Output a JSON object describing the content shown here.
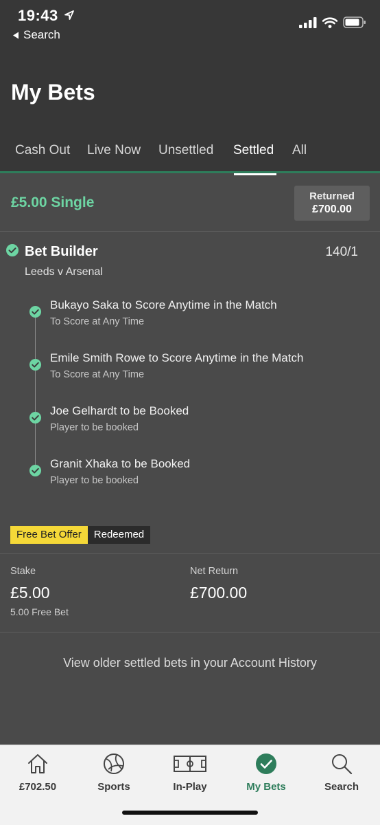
{
  "status_bar": {
    "time": "19:43",
    "back_label": "Search"
  },
  "page_title": "My Bets",
  "tabs": [
    {
      "label": "Cash Out"
    },
    {
      "label": "Live Now"
    },
    {
      "label": "Unsettled"
    },
    {
      "label": "Settled",
      "active": true
    },
    {
      "label": "All"
    }
  ],
  "bet": {
    "title": "£5.00 Single",
    "returned_label": "Returned",
    "returned_value": "£700.00",
    "builder_title": "Bet Builder",
    "odds": "140/1",
    "match": "Leeds v Arsenal",
    "legs": [
      {
        "name": "Bukayo Saka to Score Anytime in the Match",
        "market": "To Score at Any Time"
      },
      {
        "name": "Emile Smith Rowe to Score Anytime in the Match",
        "market": "To Score at Any Time"
      },
      {
        "name": "Joe Gelhardt to be Booked",
        "market": "Player to be booked"
      },
      {
        "name": "Granit Xhaka to be Booked",
        "market": "Player to be booked"
      }
    ],
    "offer_label": "Free Bet Offer",
    "offer_status": "Redeemed",
    "stake_label": "Stake",
    "stake_value": "£5.00",
    "stake_note": "5.00 Free Bet",
    "net_return_label": "Net Return",
    "net_return_value": "£700.00"
  },
  "history_link": "View older settled bets in your Account History",
  "tab_bar": {
    "items": [
      {
        "label": "£702.50",
        "icon": "home-icon"
      },
      {
        "label": "Sports",
        "icon": "football-icon"
      },
      {
        "label": "In-Play",
        "icon": "pitch-icon"
      },
      {
        "label": "My Bets",
        "icon": "check-circle-icon",
        "active": true
      },
      {
        "label": "Search",
        "icon": "search-icon"
      }
    ]
  },
  "colors": {
    "accent": "#2e7d5b",
    "win_green": "#6dd5a3",
    "offer_yellow": "#f5d838",
    "background": "#4a4a4a",
    "header": "#373737"
  }
}
